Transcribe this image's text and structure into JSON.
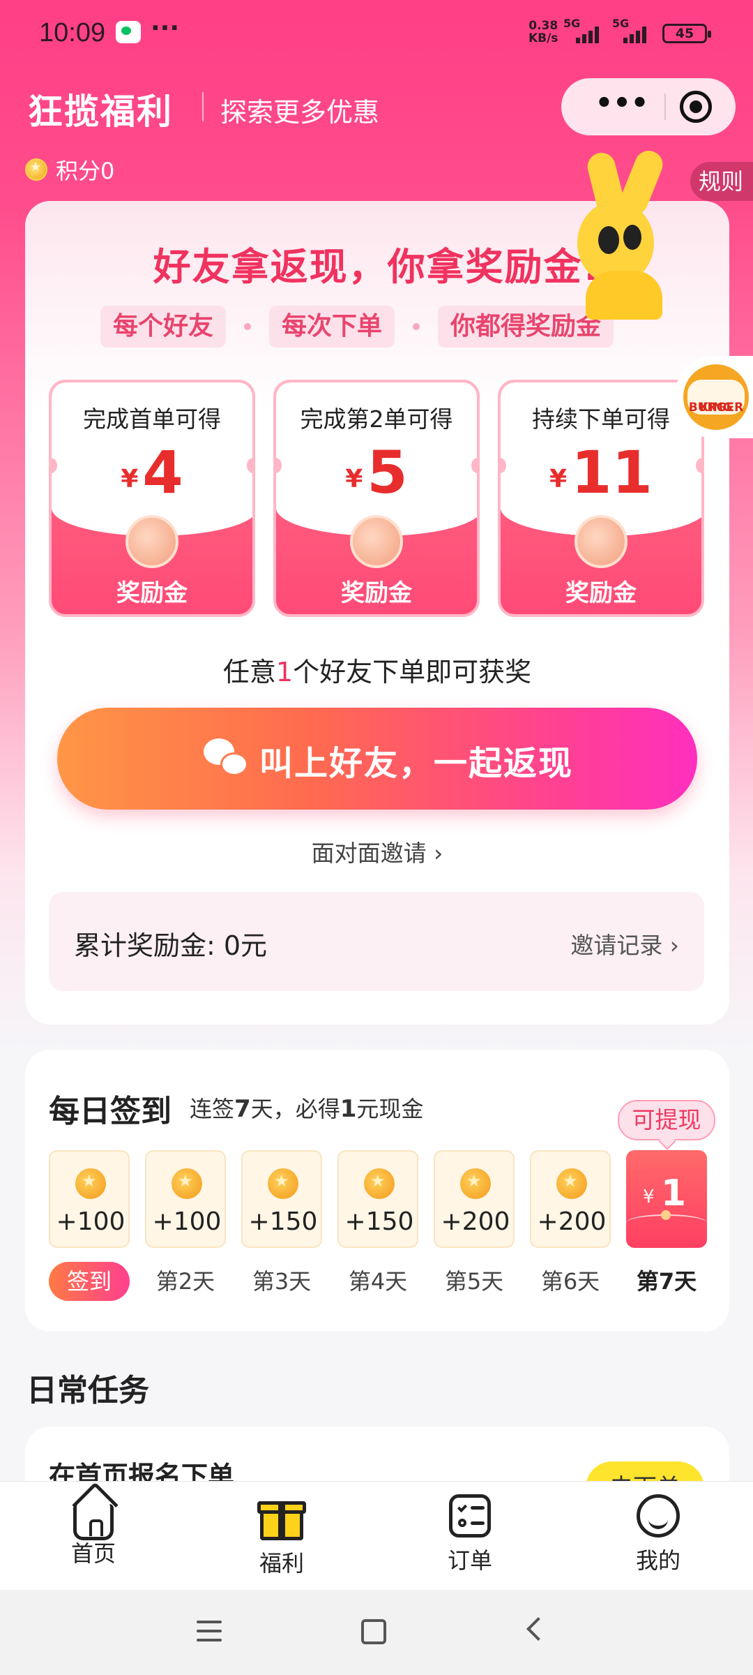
{
  "status_bar": {
    "time": "10:09",
    "net_speed_value": "0.38",
    "net_speed_unit": "KB/s",
    "network1": "5G",
    "network2": "5G",
    "battery": "45"
  },
  "header": {
    "title": "狂揽福利",
    "subtitle": "探索更多优惠",
    "more_label": "•••"
  },
  "points": {
    "label": "积分0"
  },
  "rules_label": "规则",
  "invite": {
    "headline": "好友拿返现，你拿奖励金!",
    "pills": [
      "每个好友",
      "每次下单",
      "你都得奖励金"
    ],
    "rewards": [
      {
        "condition": "完成首单可得",
        "currency": "¥",
        "amount": "4",
        "label": "奖励金"
      },
      {
        "condition": "完成第2单可得",
        "currency": "¥",
        "amount": "5",
        "label": "奖励金"
      },
      {
        "condition": "持续下单可得",
        "currency": "¥",
        "amount": "11",
        "label": "奖励金"
      }
    ],
    "any_friend_pre": "任意",
    "any_friend_num": "1",
    "any_friend_post": "个好友下单即可获奖",
    "cta_label": "叫上好友，一起返现",
    "face_to_face": "面对面邀请 ›",
    "total_label": "累计奖励金: 0元",
    "records_link": "邀请记录 ›"
  },
  "floating_brand": {
    "line1": "BURGER",
    "line2": "KING"
  },
  "checkin": {
    "title": "每日签到",
    "subtitle_pre": "连签",
    "subtitle_days": "7",
    "subtitle_mid": "天，必得",
    "subtitle_amount": "1",
    "subtitle_post": "元现金",
    "withdraw_tip": "可提现",
    "days": [
      {
        "value": "+100",
        "label": "签到"
      },
      {
        "value": "+100",
        "label": "第2天"
      },
      {
        "value": "+150",
        "label": "第3天"
      },
      {
        "value": "+150",
        "label": "第4天"
      },
      {
        "value": "+200",
        "label": "第5天"
      },
      {
        "value": "+200",
        "label": "第6天"
      },
      {
        "currency": "¥",
        "value": "1",
        "label": "第7天"
      }
    ]
  },
  "daily_tasks": {
    "title": "日常任务",
    "task1_title": "在首页报名下单",
    "task1_button": "去下单"
  },
  "tabbar": {
    "items": [
      {
        "label": "首页",
        "icon": "home-icon"
      },
      {
        "label": "福利",
        "icon": "gift-icon"
      },
      {
        "label": "订单",
        "icon": "order-icon"
      },
      {
        "label": "我的",
        "icon": "profile-icon"
      }
    ]
  },
  "colors": {
    "brand_pink": "#ff3f86",
    "accent_red": "#f0325f",
    "cta_orange": "#ff9646",
    "cta_magenta": "#ff2fbf",
    "task_yellow": "#ffe42e"
  }
}
